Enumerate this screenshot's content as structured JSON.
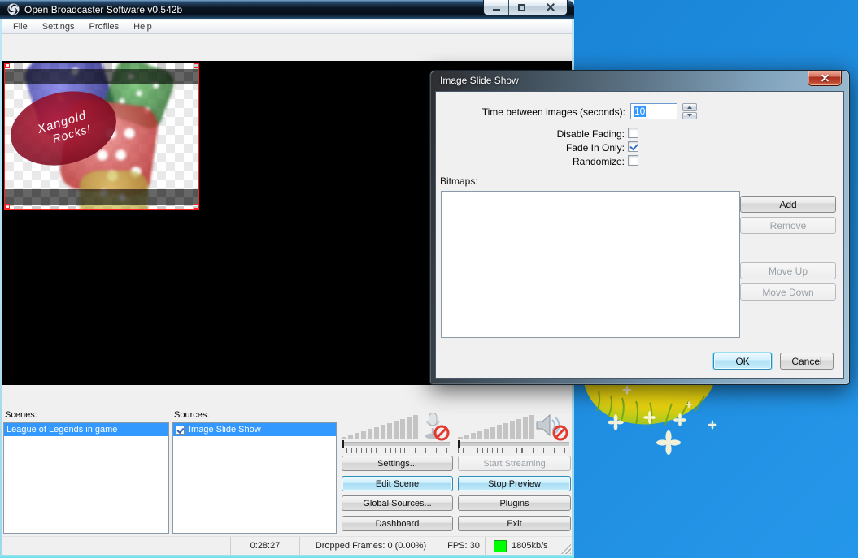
{
  "window": {
    "title": "Open Broadcaster Software v0.542b",
    "menu": {
      "file": "File",
      "settings": "Settings",
      "profiles": "Profiles",
      "help": "Help"
    },
    "scenes_label": "Scenes:",
    "sources_label": "Sources:",
    "scene_item": "League of Legends in game",
    "source_item": "Image Slide Show",
    "buttons": {
      "settings": "Settings...",
      "start_streaming": "Start Streaming",
      "edit_scene": "Edit Scene",
      "stop_preview": "Stop Preview",
      "global_sources": "Global Sources...",
      "plugins": "Plugins",
      "dashboard": "Dashboard",
      "exit": "Exit"
    },
    "status": {
      "time": "0:28:27",
      "dropped_frames": "Dropped Frames: 0 (0.00%)",
      "fps": "FPS: 30",
      "bitrate": "1805kb/s"
    }
  },
  "preview": {
    "overlay_line1": "Xangold",
    "overlay_line2": "Rocks!"
  },
  "dialog": {
    "title": "Image Slide Show",
    "time_label": "Time between images (seconds):",
    "time_value": "10",
    "disable_fading_label": "Disable Fading:",
    "fade_in_only_label": "Fade In Only:",
    "randomize_label": "Randomize:",
    "checkbox_states": {
      "disable_fading": false,
      "fade_in_only": true,
      "randomize": false
    },
    "bitmaps_label": "Bitmaps:",
    "buttons": {
      "add": "Add",
      "remove": "Remove",
      "move_up": "Move Up",
      "move_down": "Move Down",
      "ok": "OK",
      "cancel": "Cancel"
    }
  },
  "icons": {
    "logo": "obs-shutter-icon",
    "mic": "microphone-muted-icon",
    "speaker": "speaker-muted-icon"
  },
  "colors": {
    "selection": "#3399ff",
    "status_green": "#00ff00",
    "desktop_blue": "#1b86d8",
    "dialog_close_red": "#ad3120"
  }
}
